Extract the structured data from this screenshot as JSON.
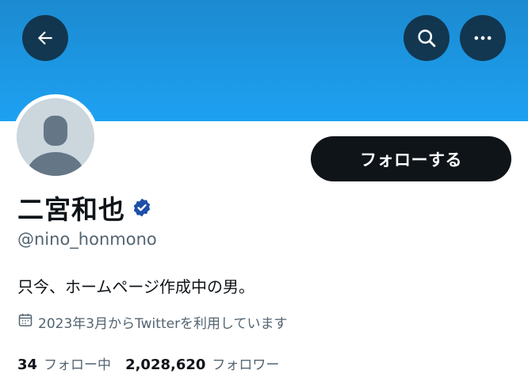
{
  "header": {
    "back_icon": "arrow-left-icon",
    "search_icon": "search-icon",
    "more_icon": "more-horizontal-icon",
    "banner_color": "#1d9bf0"
  },
  "profile": {
    "display_name": "二宮和也",
    "verified_icon": "verified-badge-icon",
    "verified_color": "#1d4fa8",
    "handle": "@nino_honmono",
    "bio": "只今、ホームページ作成中の男。",
    "joined_icon": "calendar-icon",
    "joined": "2023年3月からTwitterを利用しています"
  },
  "actions": {
    "follow_label": "フォローする"
  },
  "stats": {
    "following_count": "34",
    "following_label": "フォロー中",
    "followers_count": "2,028,620",
    "followers_label": "フォロワー"
  }
}
